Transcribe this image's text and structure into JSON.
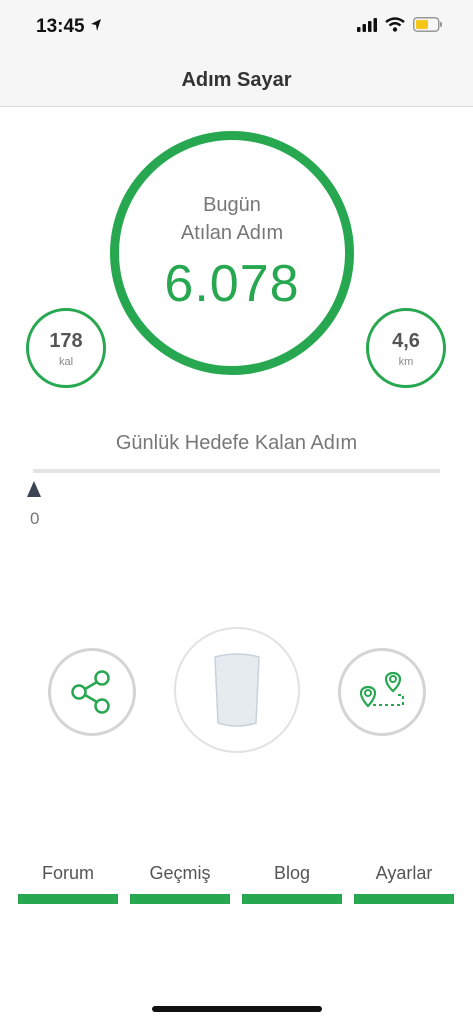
{
  "status": {
    "time": "13:45",
    "battery_color": "#f5c518"
  },
  "nav": {
    "title": "Adım Sayar"
  },
  "steps": {
    "line1": "Bugün",
    "line2": "Atılan Adım",
    "value": "6.078"
  },
  "calories": {
    "value": "178",
    "unit": "kal"
  },
  "distance": {
    "value": "4,6",
    "unit": "km"
  },
  "goal": {
    "label": "Günlük Hedefe Kalan Adım",
    "remaining": "0",
    "progress_fraction": 0
  },
  "actions": {
    "share_icon": "share-icon",
    "water_icon": "water-glass-icon",
    "route_icon": "route-map-icon"
  },
  "tabs": [
    {
      "label": "Forum"
    },
    {
      "label": "Geçmiş"
    },
    {
      "label": "Blog"
    },
    {
      "label": "Ayarlar"
    }
  ],
  "colors": {
    "accent": "#27a850",
    "ring_gray": "#d4d4d4"
  }
}
